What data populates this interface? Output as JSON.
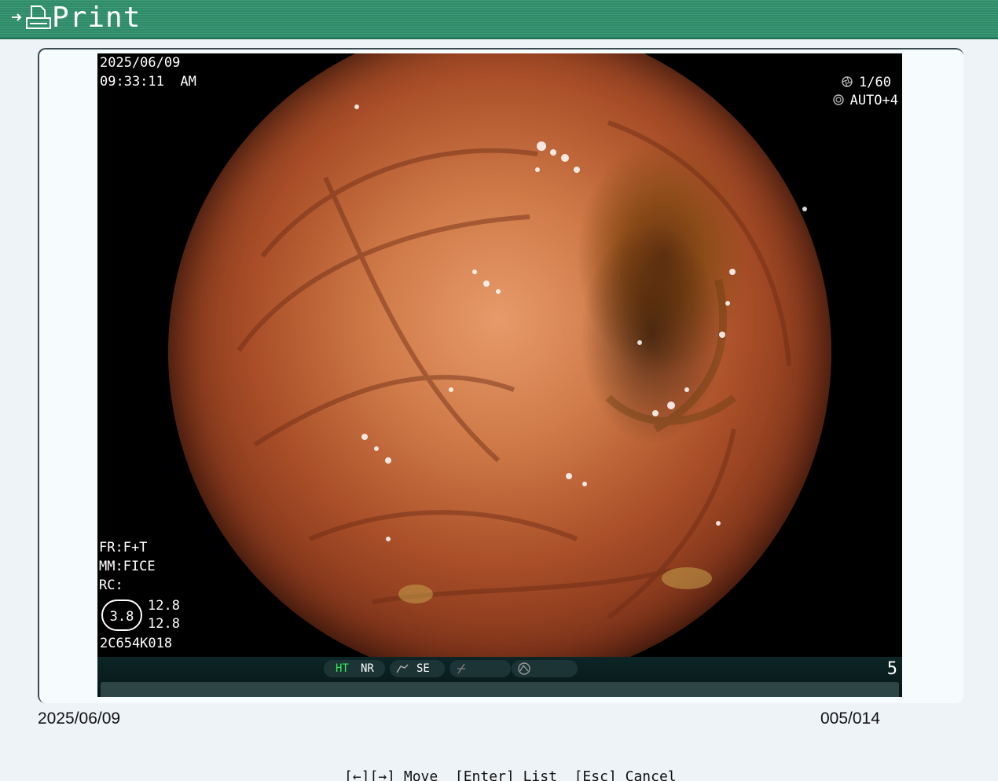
{
  "window": {
    "title": "Print"
  },
  "image": {
    "date": "2025/06/09",
    "time": "09:33:11  AM",
    "shutter": "1/60",
    "exposure": "AUTO+4",
    "fr": "FR:F+T",
    "mm": "MM:FICE",
    "rc": "RC:",
    "zoom_factor": "3.8",
    "value_1": "12.8",
    "value_2": "12.8",
    "serial": "2C654K018"
  },
  "status_strip": {
    "ht": "HT",
    "nr": "NR",
    "se": "SE",
    "zoom_level": "5",
    "ht_color": "#33ee55"
  },
  "footer": {
    "date": "2025/06/09",
    "counter": "005/014",
    "key_help": "[←][→] Move  [Enter] List  [Esc] Cancel"
  },
  "icons": [
    "arrow-right-icon",
    "printer-icon",
    "shutter-icon",
    "exposure-icon",
    "se-curve-icon",
    "c-icon",
    "d-icon"
  ]
}
